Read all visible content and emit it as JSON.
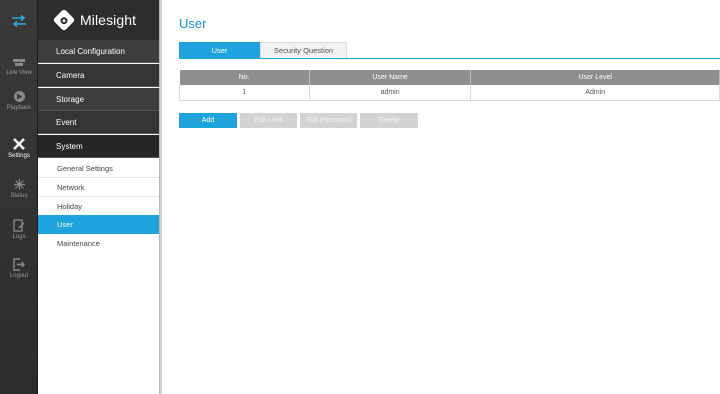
{
  "rail": {
    "items": [
      {
        "label": "Live View",
        "icon": "live-view-icon"
      },
      {
        "label": "Playback",
        "icon": "playback-icon"
      },
      {
        "label": "Settings",
        "icon": "settings-icon"
      },
      {
        "label": "Status",
        "icon": "status-icon"
      },
      {
        "label": "Logs",
        "icon": "logs-icon"
      },
      {
        "label": "Logout",
        "icon": "logout-icon"
      }
    ]
  },
  "brand": {
    "name": "Milesight"
  },
  "menu": {
    "groups": {
      "local": "Local Configuration",
      "camera": "Camera",
      "storage": "Storage",
      "event": "Event",
      "system": "System"
    },
    "system_items": [
      "General Settings",
      "Network",
      "Holiday",
      "User",
      "Maintenance"
    ],
    "active_item": "User"
  },
  "page": {
    "title": "User"
  },
  "tabs": [
    {
      "label": "User",
      "active": true
    },
    {
      "label": "Security Question",
      "active": false
    }
  ],
  "table": {
    "headers": [
      "No.",
      "User Name",
      "User Level"
    ],
    "rows": [
      [
        "1",
        "admin",
        "Admin"
      ]
    ]
  },
  "buttons": {
    "add": "Add",
    "edit_limit": "Edit Limit",
    "edit_password": "Edit Password",
    "delete": "Delete"
  },
  "colors": {
    "accent": "#1fa3dc",
    "rail_bg": "#2c2c2c",
    "menu_group_bg": "#3d3d3d",
    "header_bg": "#8e8e8e",
    "disabled": "#d3d3d3"
  }
}
